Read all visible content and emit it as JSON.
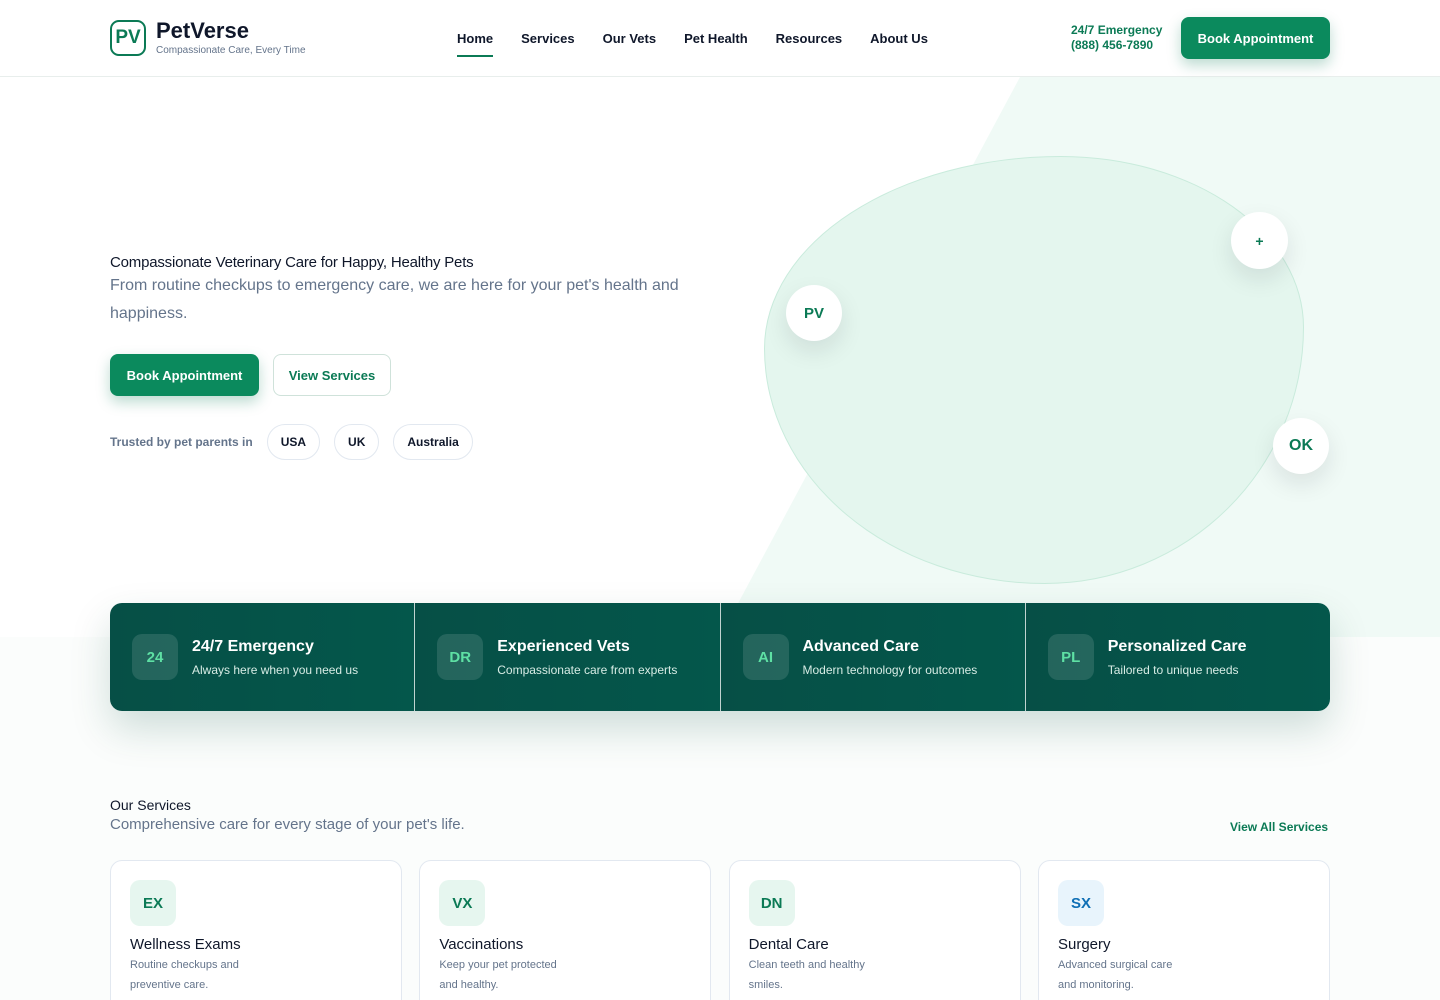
{
  "brand": {
    "badge": "PV",
    "name": "PetVerse",
    "tagline": "Compassionate Care, Every Time",
    "accent_color": "#0b7a55"
  },
  "nav": {
    "items": [
      {
        "label": "Home",
        "active": true
      },
      {
        "label": "Services"
      },
      {
        "label": "Our Vets"
      },
      {
        "label": "Pet Health"
      },
      {
        "label": "Resources"
      },
      {
        "label": "About Us"
      }
    ]
  },
  "header": {
    "emergency_label": "24/7 Emergency",
    "emergency_phone": "(888) 456-7890",
    "cta_label": "Book Appointment"
  },
  "hero": {
    "title": "Compassionate Veterinary Care for Happy, Healthy Pets",
    "subtitle": "From routine checkups to emergency care, we are here for your pet's health and happiness.",
    "primary_cta": "Book Appointment",
    "secondary_cta": "View Services",
    "trusted_label": "Trusted by pet parents in",
    "countries": [
      "USA",
      "UK",
      "Australia"
    ],
    "badges": {
      "pv": "PV",
      "plus": "+",
      "ok": "OK"
    }
  },
  "features": [
    {
      "icon": "24",
      "title": "24/7 Emergency",
      "desc": "Always here when you need us"
    },
    {
      "icon": "DR",
      "title": "Experienced Vets",
      "desc": "Compassionate care from experts"
    },
    {
      "icon": "AI",
      "title": "Advanced Care",
      "desc": "Modern technology for outcomes"
    },
    {
      "icon": "PL",
      "title": "Personalized Care",
      "desc": "Tailored to unique needs"
    }
  ],
  "services": {
    "title": "Our Services",
    "subtitle": "Comprehensive care for every stage of your pet's life.",
    "view_all": "View All Services",
    "cards": [
      {
        "icon": "EX",
        "title": "Wellness Exams",
        "desc": "Routine checkups and preventive care."
      },
      {
        "icon": "VX",
        "title": "Vaccinations",
        "desc": "Keep your pet protected and healthy."
      },
      {
        "icon": "DN",
        "title": "Dental Care",
        "desc": "Clean teeth and healthy smiles."
      },
      {
        "icon": "SX",
        "title": "Surgery",
        "desc": "Advanced surgical care and monitoring."
      }
    ]
  }
}
